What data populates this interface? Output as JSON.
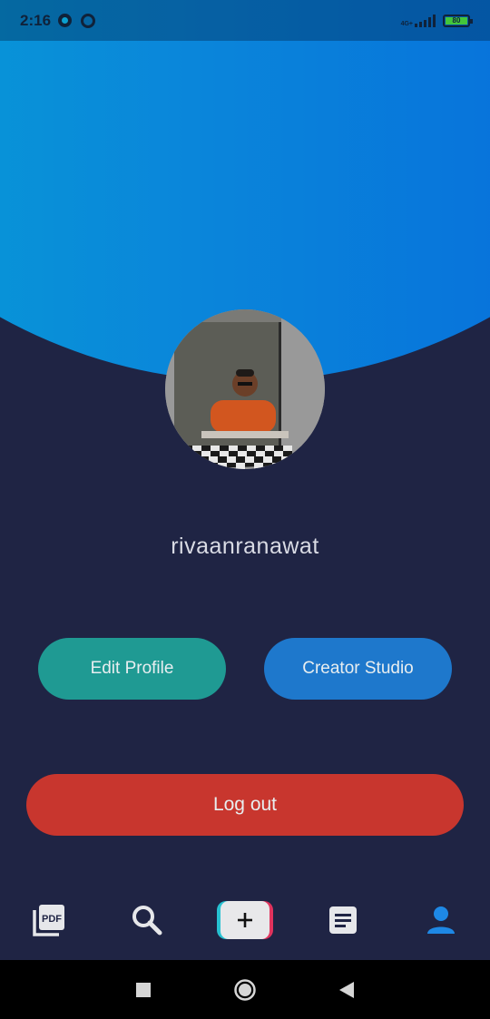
{
  "status_bar": {
    "time": "2:16",
    "network_label": "4G+",
    "battery_level": "80"
  },
  "profile": {
    "username": "rivaanranawat",
    "avatar_alt": "profile photo"
  },
  "actions": {
    "edit_profile": "Edit Profile",
    "creator_studio": "Creator Studio",
    "logout": "Log out"
  },
  "bottom_nav": {
    "items": [
      {
        "name": "pdf-icon",
        "active": false
      },
      {
        "name": "search-icon",
        "active": false
      },
      {
        "name": "add-icon",
        "active": false
      },
      {
        "name": "document-icon",
        "active": false
      },
      {
        "name": "profile-icon",
        "active": true
      }
    ]
  },
  "colors": {
    "background": "#1f2444",
    "header_gradient_start": "#06a5d4",
    "header_gradient_end": "#0563dc",
    "edit_button": "#1f9a93",
    "studio_button": "#1e78cc",
    "logout_button": "#c8362e",
    "active_nav": "#1e88e5"
  }
}
